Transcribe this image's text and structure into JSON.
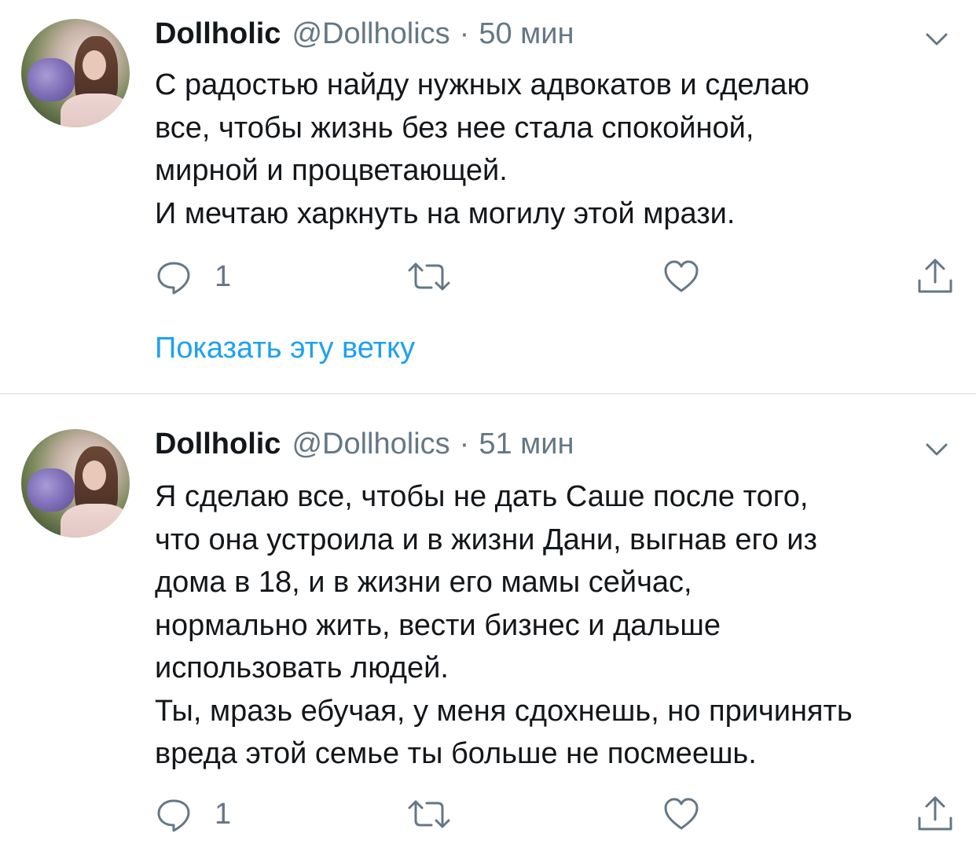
{
  "tweets": [
    {
      "author_name": "Dollholic",
      "author_handle": "@Dollholics",
      "separator": "·",
      "time": "50 мин",
      "lines": [
        "С радостью найду нужных адвокатов и сделаю",
        "все, чтобы жизнь без нее стала спокойной,",
        "мирной и процветающей.",
        "И мечтаю харкнуть на могилу этой мрази."
      ],
      "reply_count": "1",
      "icons": [
        "reply-icon",
        "retweet-icon",
        "like-icon",
        "share-icon",
        "chevron-down-icon"
      ],
      "show_thread_label": "Показать эту ветку"
    },
    {
      "author_name": "Dollholic",
      "author_handle": "@Dollholics",
      "separator": "·",
      "time": "51 мин",
      "lines": [
        "Я сделаю все, чтобы не дать Саше после того,",
        "что она устроила и в жизни Дани, выгнав его из",
        "дома в 18, и в жизни его мамы сейчас,",
        "нормально жить,  вести бизнес и дальше",
        "использовать людей.",
        "Ты, мразь ебучая, у меня сдохнешь, но причинять",
        "вреда этой семье ты больше не посмеешь."
      ],
      "reply_count": "1",
      "icons": [
        "reply-icon",
        "retweet-icon",
        "like-icon",
        "share-icon",
        "chevron-down-icon"
      ]
    }
  ],
  "colors": {
    "text": "#14171a",
    "secondary": "#657786",
    "link": "#1da1f2",
    "divider": "#e6ecf0"
  }
}
